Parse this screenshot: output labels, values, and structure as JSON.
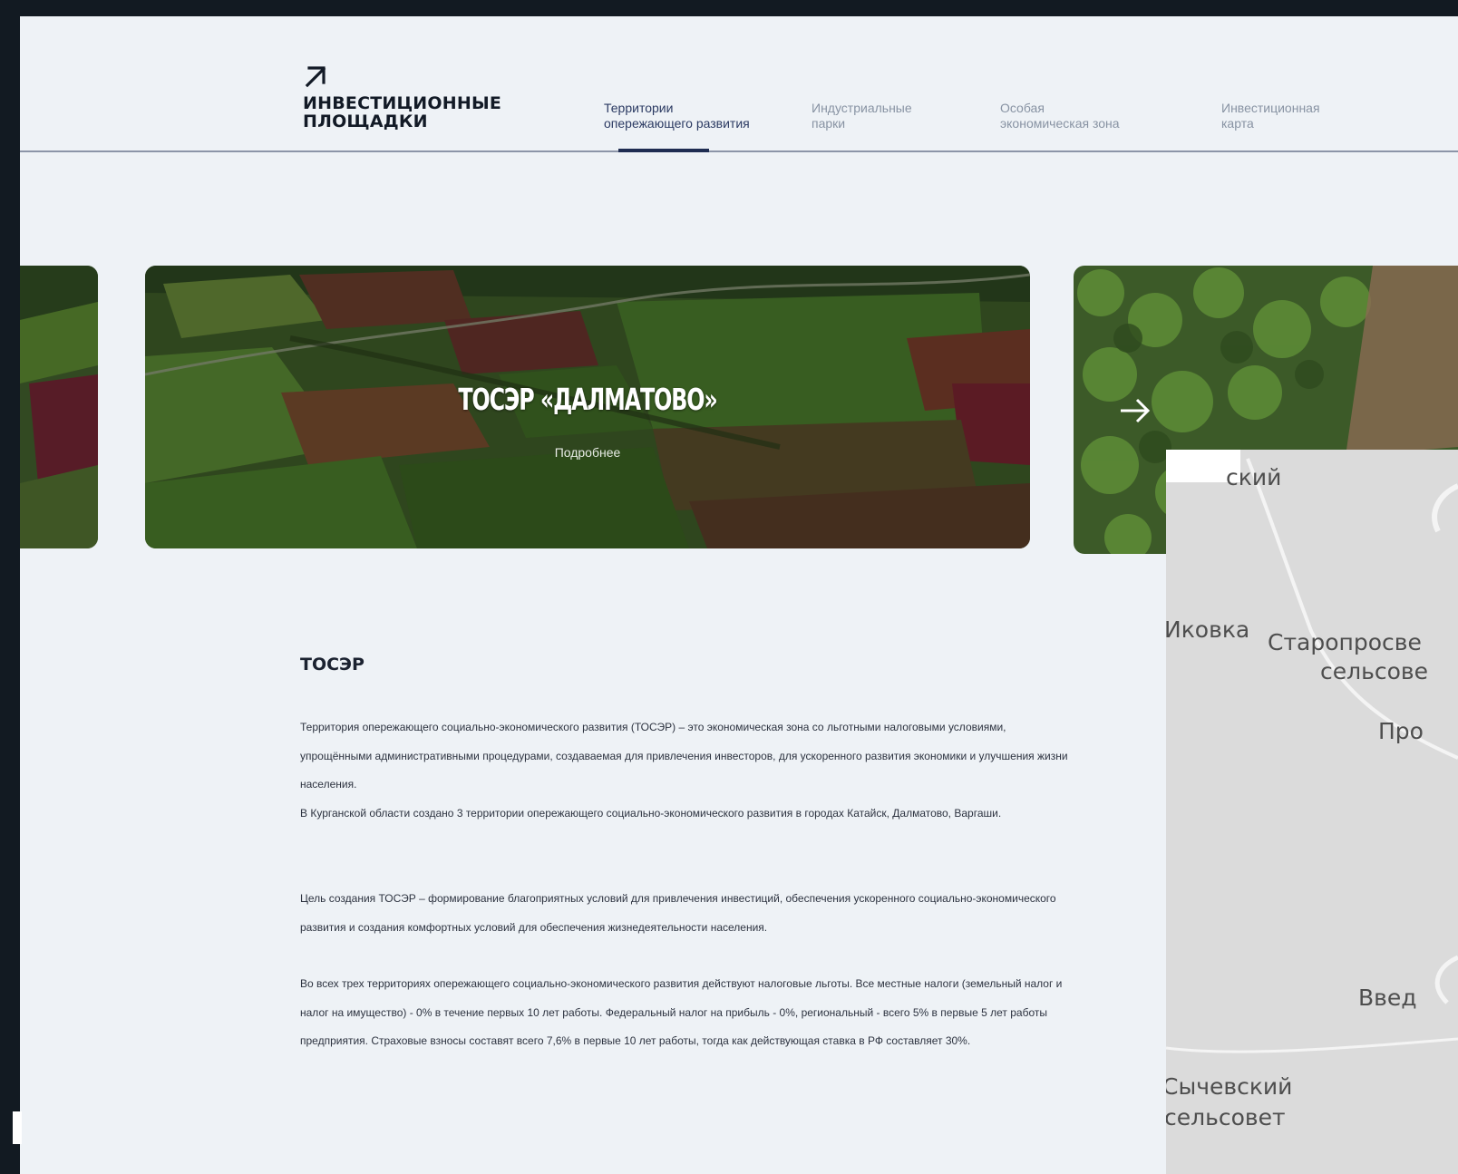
{
  "header": {
    "logo_text": "ИНВЕСТИЦИОННЫЕ ПЛОЩАДКИ",
    "nav": [
      {
        "label": "Территории\nопережающего развития",
        "active": true
      },
      {
        "label": "Индустриальные\nпарки",
        "active": false
      },
      {
        "label": "Особая\nэкономическая зона",
        "active": false
      },
      {
        "label": "Инвестиционная\nкарта",
        "active": false
      }
    ]
  },
  "carousel": {
    "active_slide": {
      "title": "ТОСЭР «ДАЛМАТОВО»",
      "more_label": "Подробнее"
    }
  },
  "map": {
    "labels": [
      "ский",
      "Иковка",
      "Старопросве",
      "сельсове",
      "Про",
      "Введ",
      "Сычевский",
      "сельсовет"
    ]
  },
  "content": {
    "title": "ТОСЭР",
    "paragraph_1": "Территория опережающего социально-экономического развития (ТОСЭР) – это экономическая зона со льготными налоговыми условиями, упрощёнными административными процедурами, создаваемая для привлечения инвесторов, для ускоренного развития экономики и улучшения жизни населения.",
    "paragraph_1b": "В Курганской области создано 3 территории опережающего социально-экономического развития в городах Катайск, Далматово, Варгаши.",
    "paragraph_2": "Цель создания ТОСЭР – формирование благоприятных условий для привлечения инвестиций, обеспечения ускоренного социально-экономического развития и создания комфортных условий для обеспечения жизнедеятельности населения.",
    "paragraph_3": "Во всех трех территориях опережающего социально-экономического развития действуют налоговые льготы. Все местные налоги (земельный налог и налог на имущество) - 0% в течение первых 10 лет работы. Федеральный налог на прибыль - 0%, региональный - всего 5% в первые 5 лет работы предприятия. Страховые взносы составят всего 7,6% в первые 10 лет работы, тогда как действующая ставка  в РФ составляет 30%."
  },
  "colors": {
    "page_bg": "#eef2f6",
    "frame_bg": "#121a22",
    "nav_active": "#2b3a62",
    "nav_inactive": "#8893a3",
    "accent": "#1f2d52",
    "map_bg": "#dbdbdb"
  }
}
